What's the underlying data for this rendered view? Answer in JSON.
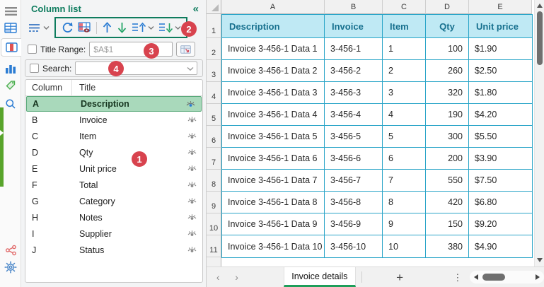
{
  "colors": {
    "panel_accent_teal": "#0e7c5e",
    "badge_red": "#d8434e",
    "grid_border_cyan": "#2aa5c8",
    "sheet_header_fill": "#bfe9f4",
    "sheet_header_text": "#17708e",
    "selected_row_fill": "#a9d9bb",
    "selected_row_border": "#5aa97a",
    "sheet_tab_underline_green": "#1e9e5a",
    "sidebar_strip_green": "#58a42b",
    "icon_blue": "#2b7cd3",
    "icon_green": "#21a366",
    "icon_red": "#e06868"
  },
  "sidebar": {
    "items": [
      {
        "name": "menu"
      },
      {
        "name": "table-view"
      },
      {
        "name": "column-list",
        "active": true
      },
      {
        "name": "chart"
      },
      {
        "name": "tag"
      },
      {
        "name": "search"
      },
      {
        "name": "share"
      },
      {
        "name": "settings"
      }
    ]
  },
  "panel": {
    "title": "Column list",
    "collapse_icon": "«",
    "badges": {
      "b1": "1",
      "b2": "2",
      "b3": "3",
      "b4": "4"
    },
    "title_range": {
      "label": "Title Range:",
      "value": "$A$1",
      "checked": false
    },
    "search": {
      "label": "Search:",
      "value": "",
      "checked": false
    },
    "list": {
      "header": {
        "column": "Column",
        "title": "Title"
      },
      "rows": [
        {
          "column": "A",
          "title": "Description",
          "selected": true,
          "visible": true
        },
        {
          "column": "B",
          "title": "Invoice",
          "visible": true
        },
        {
          "column": "C",
          "title": "Item",
          "visible": true
        },
        {
          "column": "D",
          "title": "Qty",
          "visible": true
        },
        {
          "column": "E",
          "title": "Unit price",
          "visible": true
        },
        {
          "column": "F",
          "title": "Total",
          "visible": true
        },
        {
          "column": "G",
          "title": "Category",
          "visible": true
        },
        {
          "column": "H",
          "title": "Notes",
          "visible": true
        },
        {
          "column": "I",
          "title": "Supplier",
          "visible": true
        },
        {
          "column": "J",
          "title": "Status",
          "visible": true
        }
      ]
    }
  },
  "sheet": {
    "column_letters": [
      "A",
      "B",
      "C",
      "D",
      "E"
    ],
    "header_row": {
      "row_number": "1",
      "cells": [
        "Description",
        "Invoice",
        "Item",
        "Qty",
        "Unit price"
      ]
    },
    "data_rows": [
      {
        "row_number": "2",
        "description": "Invoice 3-456-1 Data 1",
        "invoice": "3-456-1",
        "item": "1",
        "qty": "100",
        "unit_price": "$1.90"
      },
      {
        "row_number": "3",
        "description": "Invoice 3-456-1 Data 2",
        "invoice": "3-456-2",
        "item": "2",
        "qty": "260",
        "unit_price": "$2.50"
      },
      {
        "row_number": "4",
        "description": "Invoice 3-456-1 Data 3",
        "invoice": "3-456-3",
        "item": "3",
        "qty": "320",
        "unit_price": "$1.80"
      },
      {
        "row_number": "5",
        "description": "Invoice 3-456-1 Data 4",
        "invoice": "3-456-4",
        "item": "4",
        "qty": "190",
        "unit_price": "$4.20"
      },
      {
        "row_number": "6",
        "description": "Invoice 3-456-1 Data 5",
        "invoice": "3-456-5",
        "item": "5",
        "qty": "300",
        "unit_price": "$5.50"
      },
      {
        "row_number": "7",
        "description": "Invoice 3-456-1 Data 6",
        "invoice": "3-456-6",
        "item": "6",
        "qty": "200",
        "unit_price": "$3.90"
      },
      {
        "row_number": "8",
        "description": "Invoice 3-456-1 Data 7",
        "invoice": "3-456-7",
        "item": "7",
        "qty": "550",
        "unit_price": "$7.50"
      },
      {
        "row_number": "9",
        "description": "Invoice 3-456-1 Data 8",
        "invoice": "3-456-8",
        "item": "8",
        "qty": "420",
        "unit_price": "$6.80"
      },
      {
        "row_number": "10",
        "description": "Invoice 3-456-1 Data 9",
        "invoice": "3-456-9",
        "item": "9",
        "qty": "150",
        "unit_price": "$9.20"
      },
      {
        "row_number": "11",
        "description": "Invoice 3-456-1 Data 10",
        "invoice": "3-456-10",
        "item": "10",
        "qty": "380",
        "unit_price": "$4.90"
      }
    ],
    "tab_bar": {
      "prev_icon": "‹",
      "next_icon": "›",
      "sheet_tab": "Invoice details",
      "add_icon": "+",
      "more_icon": "⋮"
    }
  }
}
